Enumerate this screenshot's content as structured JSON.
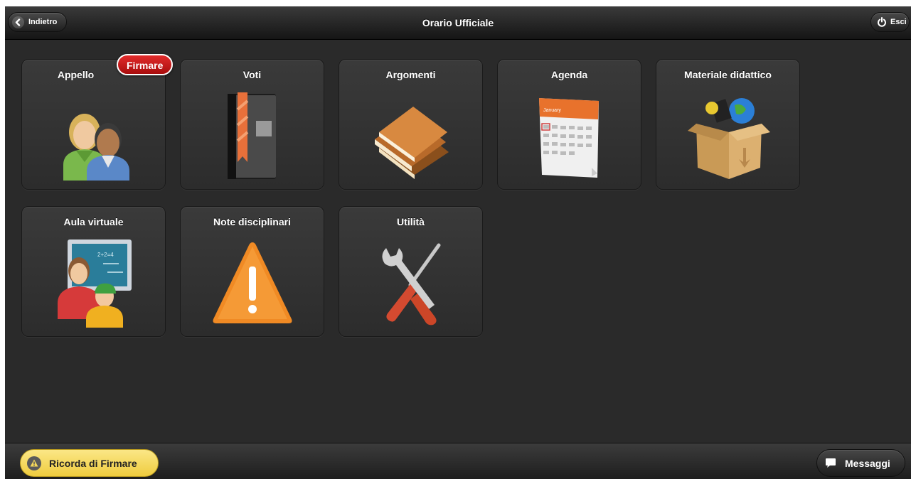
{
  "header": {
    "title": "Orario Ufficiale",
    "back_label": "Indietro",
    "exit_label": "Esci"
  },
  "tiles": [
    {
      "label": "Appello",
      "icon": "people-icon",
      "badge": "Firmare"
    },
    {
      "label": "Voti",
      "icon": "gradebook-icon"
    },
    {
      "label": "Argomenti",
      "icon": "books-icon"
    },
    {
      "label": "Agenda",
      "icon": "calendar-icon",
      "icon_text": "January"
    },
    {
      "label": "Materiale didattico",
      "icon": "materials-box-icon"
    },
    {
      "label": "Aula virtuale",
      "icon": "virtual-classroom-icon",
      "icon_text": "2+2=4"
    },
    {
      "label": "Note disciplinari",
      "icon": "warning-icon"
    },
    {
      "label": "Utilità",
      "icon": "tools-icon"
    }
  ],
  "footer": {
    "remind_label": "Ricorda di Firmare",
    "messages_label": "Messaggi"
  },
  "colors": {
    "background": "#2a2a2a",
    "badge": "#c81818",
    "remind_button": "#f5d85a",
    "tile": "#353535"
  }
}
